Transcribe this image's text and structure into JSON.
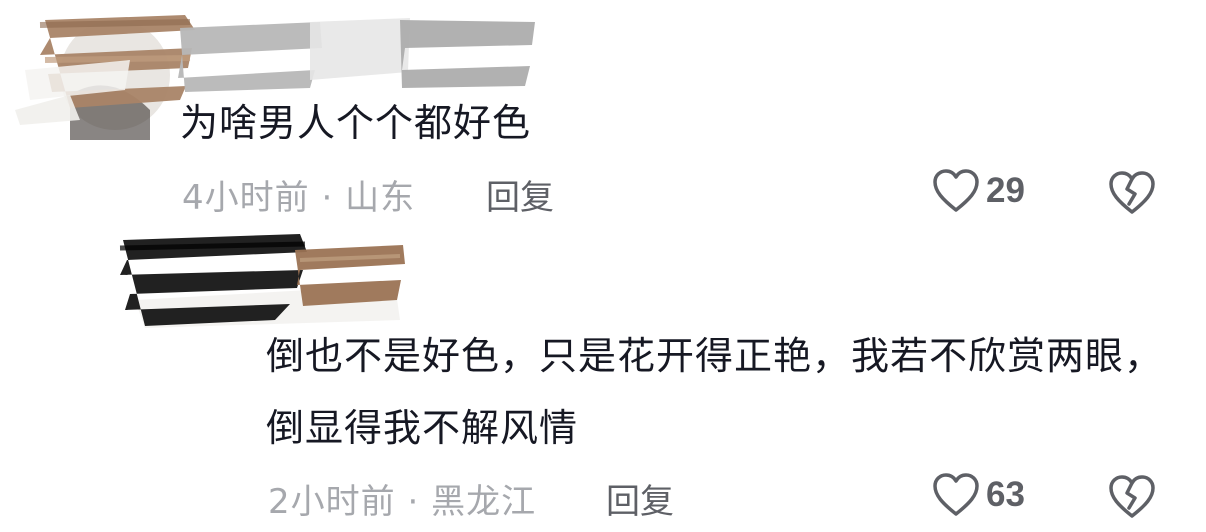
{
  "comments": [
    {
      "text": "为啥男人个个都好色",
      "time": "4小时前",
      "separator": " · ",
      "location": "山东",
      "reply_label": "回复",
      "like_count": "29"
    },
    {
      "text": "倒也不是好色，只是花开得正艳，我若不欣赏两眼，倒显得我不解风情",
      "time": "2小时前",
      "separator": " · ",
      "location": "黑龙江",
      "reply_label": "回复",
      "like_count": "63"
    }
  ],
  "icons": {
    "like": "heart-outline-icon",
    "dislike": "broken-heart-icon"
  },
  "colors": {
    "text": "#161823",
    "meta": "#a6a8ad",
    "action": "#5e6066"
  }
}
